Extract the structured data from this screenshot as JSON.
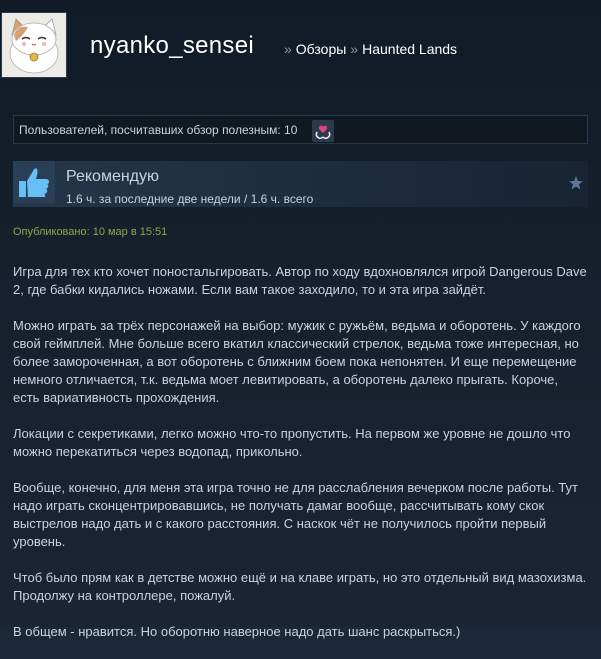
{
  "header": {
    "user_name": "nyanko_sensei",
    "breadcrumb_sep": "»",
    "breadcrumb_reviews": "Обзоры",
    "breadcrumb_game": "Haunted Lands"
  },
  "helpful": {
    "text": "Пользователей, посчитавших обзор полезным: 10",
    "award_icon": "award-icon"
  },
  "recommendation": {
    "title": "Рекомендую",
    "hours": "1.6 ч. за последние две недели / 1.6 ч. всего",
    "thumb_icon": "thumbs-up-icon",
    "star_icon": "star-icon"
  },
  "posted": "Опубликовано: 10 мар в 15:51",
  "review": {
    "paragraphs": [
      "Игра для тех кто хочет поностальгировать. Автор по ходу вдохновлялся игрой Dangerous Dave 2, где бабки кидались ножами. Если вам такое заходило, то и эта игра зайдёт.",
      "Можно играть за трёх персонажей на выбор: мужик с ружьём, ведьма и оборотень. У каждого свой геймплей. Мне больше всего вкатил классический стрелок, ведьма тоже интересная, но более замороченная, а вот оборотень с ближним боем пока непонятен. И еще перемещение немного отличается, т.к. ведьма моет левитировать, а оборотень далеко прыгать. Короче, есть вариативность прохождения.",
      "Локации с секретиками, легко можно что-то пропустить. На первом же уровне не дошло что можно перекатиться через водопад, прикольно.",
      "Вообще, конечно, для меня эта игра точно не для расслабления вечерком после работы. Тут надо играть сконцентрировавшись, не получать дамаг вообще, рассчитывать кому скок выстрелов надо дать и с какого расстояния. С наскок чёт не получилось пройти первый уровень.",
      "Чтоб было прям как в детстве можно ещё и на клаве играть, но это отдельный вид мазохизма. Продолжу на контроллере, пожалуй.",
      "В общем - нравится. Но оборотню наверное надо дать шанс раскрыться.)"
    ]
  },
  "colors": {
    "background": "#1b2838",
    "posted_green": "#8ba84a",
    "thumb_blue": "#66c0f4"
  }
}
